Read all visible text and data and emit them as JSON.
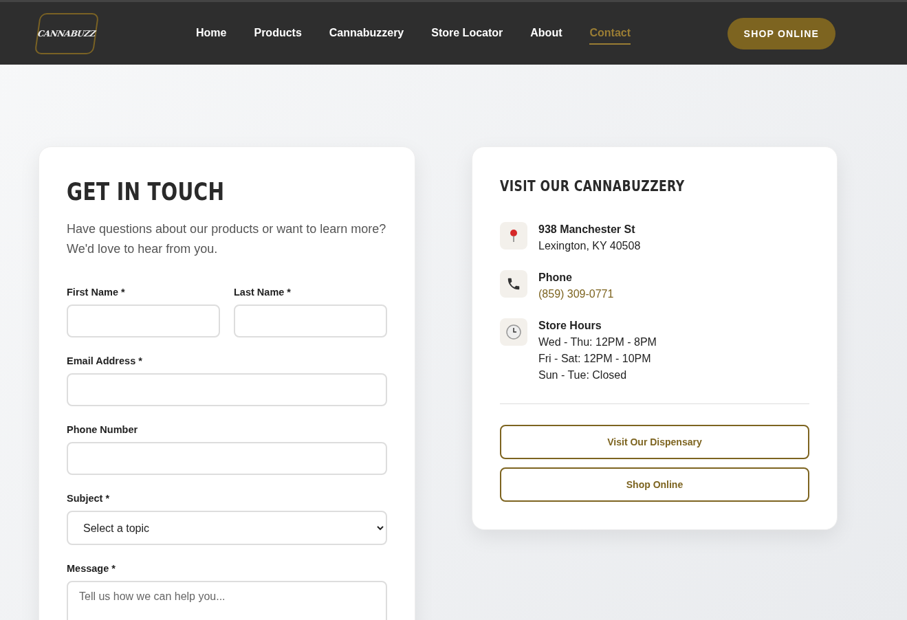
{
  "header": {
    "logo": "CANNABUZZ",
    "nav": [
      {
        "label": "Home",
        "selected": false
      },
      {
        "label": "Products",
        "selected": false
      },
      {
        "label": "Cannabuzzery",
        "selected": false
      },
      {
        "label": "Store Locator",
        "selected": false
      },
      {
        "label": "About",
        "selected": false
      },
      {
        "label": "Contact",
        "selected": true
      }
    ],
    "cta": "SHOP ONLINE"
  },
  "form_card": {
    "title": "GET IN TOUCH",
    "intro": "Have questions about our products or want to learn more? We'd love to hear from you.",
    "rows": [
      [
        {
          "label": "First Name *",
          "kind": "text"
        },
        {
          "label": "Last Name *",
          "kind": "text"
        }
      ],
      [
        {
          "label": "Email Address *",
          "kind": "text"
        }
      ],
      [
        {
          "label": "Phone Number",
          "kind": "text"
        }
      ],
      [
        {
          "label": "Subject *",
          "kind": "select",
          "value": "Select a topic"
        }
      ],
      [
        {
          "label": "Message *",
          "kind": "textarea",
          "placeholder": "Tell us how we can help you..."
        }
      ]
    ]
  },
  "visit_card": {
    "title": "VISIT OUR CANNABUZZERY",
    "items": [
      {
        "kind": "address",
        "lines": [
          "938 Manchester St",
          "Lexington, KY 40508"
        ]
      },
      {
        "kind": "phone",
        "heading": "Phone",
        "link": "(859) 309-0771"
      },
      {
        "kind": "hours",
        "heading": "Store Hours",
        "lines": [
          "Wed - Thu: 12PM - 8PM",
          "Fri - Sat: 12PM - 10PM",
          "Sun - Tue: Closed"
        ]
      }
    ],
    "buttons": [
      "Visit Our Dispensary",
      "Shop Online"
    ]
  }
}
